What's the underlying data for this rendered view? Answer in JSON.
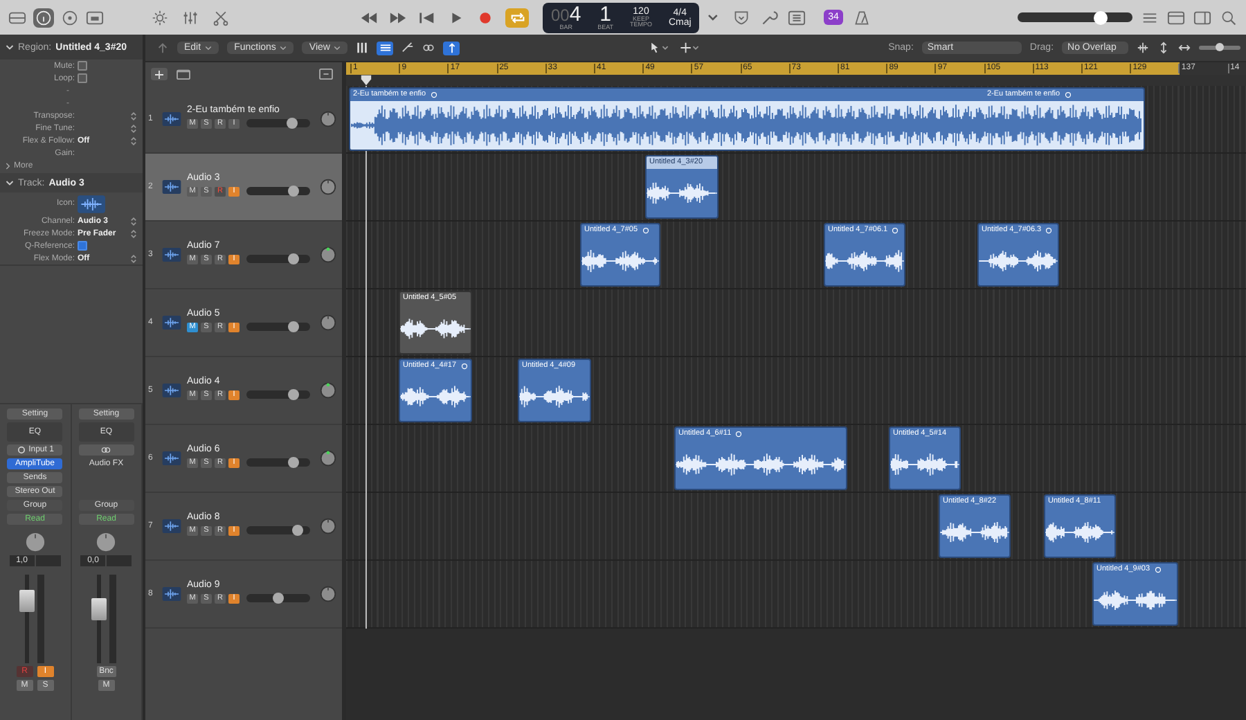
{
  "toolbar": {
    "lcd": {
      "bar_prefix": "00",
      "bar": "4",
      "beat": "1",
      "bar_label": "BAR",
      "beat_label": "BEAT",
      "tempo": "120",
      "tempo_mode": "KEEP",
      "tempo_label": "TEMPO",
      "signature": "4/4",
      "key": "Cmaj"
    },
    "cycle_on": true,
    "badge": "34",
    "master": {
      "level": 0.72
    }
  },
  "inspector": {
    "region": {
      "label": "Region:",
      "name": "Untitled 4_3#20",
      "more": "More",
      "rows": [
        {
          "kind": "checkbox",
          "label": "Mute:",
          "checked": false
        },
        {
          "kind": "checkbox",
          "label": "Loop:",
          "checked": false
        },
        {
          "kind": "dash",
          "value": "-"
        },
        {
          "kind": "dash",
          "value": "-"
        },
        {
          "kind": "stepper",
          "label": "Transpose:"
        },
        {
          "kind": "stepper",
          "label": "Fine Tune:"
        },
        {
          "kind": "stepper",
          "label": "Flex & Follow:",
          "value": "Off"
        },
        {
          "kind": "plain",
          "label": "Gain:"
        }
      ]
    },
    "track": {
      "label": "Track:",
      "name": "Audio 3",
      "rows": [
        {
          "kind": "icon",
          "label": "Icon:"
        },
        {
          "kind": "stepper",
          "label": "Channel:",
          "value": "Audio 3"
        },
        {
          "kind": "stepper",
          "label": "Freeze Mode:",
          "value": "Pre Fader"
        },
        {
          "kind": "checkbox",
          "label": "Q-Reference:",
          "checked": true
        },
        {
          "kind": "stepper",
          "label": "Flex Mode:",
          "value": "Off"
        }
      ]
    },
    "strips": [
      {
        "setting": "Setting",
        "eq": "EQ",
        "input": {
          "kind": "input",
          "label": "Input 1"
        },
        "plugin": {
          "label": "AmpliTube",
          "active": true
        },
        "sends": "Sends",
        "output": "Stereo Out",
        "group": "Group",
        "automation": "Read",
        "value": "1,0",
        "level": 0.72,
        "buttons": [
          {
            "label": "R",
            "kind": "record"
          },
          {
            "label": "I",
            "kind": "input"
          }
        ],
        "bottom": [
          "M",
          "S"
        ]
      },
      {
        "setting": "Setting",
        "eq": "EQ",
        "input": {
          "kind": "link"
        },
        "plugin": {
          "label": "Audio FX",
          "active": false
        },
        "group": "Group",
        "automation": "Read",
        "value": "0,0",
        "level": 0.62,
        "buttons": [
          {
            "label": "Bnc",
            "kind": "bounce"
          }
        ],
        "bottom": [
          "M"
        ]
      }
    ]
  },
  "tracks_bar": {
    "menus": [
      "Edit",
      "Functions",
      "View"
    ],
    "snap_label": "Snap:",
    "snap": "Smart",
    "drag_label": "Drag:",
    "drag": "No Overlap",
    "zoom": {
      "level": 0.5
    }
  },
  "ruler": [
    "1",
    "9",
    "17",
    "25",
    "33",
    "41",
    "49",
    "57",
    "65",
    "73",
    "81",
    "89",
    "97",
    "105",
    "113",
    "121",
    "129",
    "137",
    "14"
  ],
  "tracks": [
    {
      "number": "1",
      "name": "2-Eu também te enfio",
      "selected": false,
      "level": 0.72,
      "pan_indicator": false,
      "buttons": [
        {
          "label": "M",
          "on": false
        },
        {
          "label": "S",
          "on": false
        },
        {
          "label": "R",
          "on": false
        },
        {
          "label": "I",
          "on": false
        }
      ],
      "regions": [
        {
          "labels": [
            "2-Eu também te enfio",
            "2-Eu também te enfio"
          ],
          "selected": false,
          "muted": false,
          "looped": true
        }
      ]
    },
    {
      "number": "2",
      "name": "Audio 3",
      "selected": true,
      "level": 0.74,
      "pan_indicator": false,
      "buttons": [
        {
          "label": "M",
          "on": false
        },
        {
          "label": "S",
          "on": false
        },
        {
          "label": "R",
          "on": true
        },
        {
          "label": "I",
          "on": true
        }
      ],
      "regions": [
        {
          "labels": [
            "Untitled 4_3#20"
          ],
          "selected": true,
          "muted": false,
          "looped": false
        }
      ]
    },
    {
      "number": "3",
      "name": "Audio 7",
      "selected": false,
      "level": 0.74,
      "pan_indicator": true,
      "buttons": [
        {
          "label": "M",
          "on": false
        },
        {
          "label": "S",
          "on": false
        },
        {
          "label": "R",
          "on": false
        },
        {
          "label": "I",
          "on": true
        }
      ],
      "regions": [
        {
          "labels": [
            "Untitled 4_7#05"
          ],
          "selected": false,
          "muted": false,
          "looped": true
        },
        {
          "labels": [
            "Untitled 4_7#06.1"
          ],
          "selected": false,
          "muted": false,
          "looped": true
        },
        {
          "labels": [
            "Untitled 4_7#06.3"
          ],
          "selected": false,
          "muted": false,
          "looped": true
        }
      ]
    },
    {
      "number": "4",
      "name": "Audio 5",
      "selected": false,
      "level": 0.74,
      "pan_indicator": false,
      "buttons": [
        {
          "label": "M",
          "on": true
        },
        {
          "label": "S",
          "on": false
        },
        {
          "label": "R",
          "on": false
        },
        {
          "label": "I",
          "on": true
        }
      ],
      "regions": [
        {
          "labels": [
            "Untitled 4_5#05"
          ],
          "selected": false,
          "muted": true,
          "looped": false
        }
      ]
    },
    {
      "number": "5",
      "name": "Audio 4",
      "selected": false,
      "level": 0.74,
      "pan_indicator": true,
      "buttons": [
        {
          "label": "M",
          "on": false
        },
        {
          "label": "S",
          "on": false
        },
        {
          "label": "R",
          "on": false
        },
        {
          "label": "I",
          "on": true
        }
      ],
      "regions": [
        {
          "labels": [
            "Untitled 4_4#17"
          ],
          "selected": false,
          "muted": false,
          "looped": true
        },
        {
          "labels": [
            "Untitled 4_4#09"
          ],
          "selected": false,
          "muted": false,
          "looped": false
        }
      ]
    },
    {
      "number": "6",
      "name": "Audio 6",
      "selected": false,
      "level": 0.74,
      "pan_indicator": true,
      "buttons": [
        {
          "label": "M",
          "on": false
        },
        {
          "label": "S",
          "on": false
        },
        {
          "label": "R",
          "on": false
        },
        {
          "label": "I",
          "on": true
        }
      ],
      "regions": [
        {
          "labels": [
            "Untitled 4_6#11"
          ],
          "selected": false,
          "muted": false,
          "looped": true
        },
        {
          "labels": [
            "Untitled 4_5#14"
          ],
          "selected": false,
          "muted": false,
          "looped": false
        }
      ]
    },
    {
      "number": "7",
      "name": "Audio 8",
      "selected": false,
      "level": 0.8,
      "pan_indicator": false,
      "buttons": [
        {
          "label": "M",
          "on": false
        },
        {
          "label": "S",
          "on": false
        },
        {
          "label": "R",
          "on": false
        },
        {
          "label": "I",
          "on": true
        }
      ],
      "regions": [
        {
          "labels": [
            "Untitled 4_8#22"
          ],
          "selected": false,
          "muted": false,
          "looped": false
        },
        {
          "labels": [
            "Untitled 4_8#11"
          ],
          "selected": false,
          "muted": false,
          "looped": false
        }
      ]
    },
    {
      "number": "8",
      "name": "Audio 9",
      "selected": false,
      "level": 0.5,
      "pan_indicator": false,
      "buttons": [
        {
          "label": "M",
          "on": false
        },
        {
          "label": "S",
          "on": false
        },
        {
          "label": "R",
          "on": false
        },
        {
          "label": "I",
          "on": true
        }
      ],
      "regions": [
        {
          "labels": [
            "Untitled 4_9#03"
          ],
          "selected": false,
          "muted": false,
          "looped": true
        }
      ]
    }
  ]
}
